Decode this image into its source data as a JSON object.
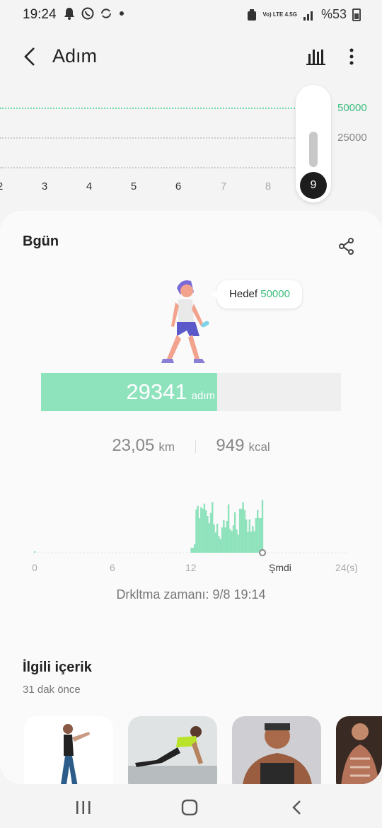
{
  "status_bar": {
    "time": "19:24",
    "left_icons": [
      "notification-icon",
      "whatsapp-icon",
      "sync-icon",
      "dot-icon"
    ],
    "network": "Vo) LTE 4.5G",
    "battery": "%53"
  },
  "header": {
    "title": "Adım",
    "back_icon": "back-arrow-icon",
    "chart_icon": "bar-chart-icon",
    "more_icon": "more-vert-icon"
  },
  "top_chart": {
    "goal_label": "50000",
    "mid_label": "25000",
    "days": [
      "2",
      "3",
      "4",
      "5",
      "6",
      "7",
      "8"
    ],
    "selected_day": "9"
  },
  "today_card": {
    "title": "Bgün",
    "share_icon": "share-icon",
    "goal_prefix": "Hedef",
    "goal_value": "50000",
    "steps": "29341",
    "steps_unit": "adım",
    "progress_fraction": 0.587,
    "distance": "23,05",
    "distance_unit": "km",
    "calories": "949",
    "calories_unit": "kcal",
    "hourly_axis": [
      "0",
      "6",
      "12",
      "Şmdi",
      "24(s)"
    ],
    "sync_text": "Drkltma zamanı: 9/8 19:14"
  },
  "chart_data": {
    "type": "bar",
    "title": "",
    "xlabel": "",
    "ylabel": "",
    "x_ticks": [
      "0",
      "6",
      "12",
      "Şmdi",
      "24(s)"
    ],
    "hours_range": [
      0,
      24
    ],
    "bars_relative_height": [
      0.02,
      0,
      0,
      0,
      0,
      0,
      0,
      0,
      0,
      0,
      0,
      0,
      0,
      0,
      0,
      0,
      0,
      0,
      0,
      0,
      0,
      0,
      0,
      0,
      0,
      0,
      0,
      0,
      0,
      0,
      0,
      0,
      0,
      0,
      0,
      0,
      0,
      0,
      0,
      0,
      0,
      0,
      0,
      0,
      0,
      0,
      0,
      0,
      0,
      0,
      0,
      0,
      0,
      0,
      0,
      0,
      0,
      0,
      0,
      0,
      0,
      0,
      0,
      0,
      0,
      0,
      0,
      0,
      0,
      0,
      0,
      0,
      0,
      0,
      0,
      0,
      0,
      0,
      0,
      0,
      0,
      0,
      0,
      0,
      0,
      0,
      0,
      0,
      0,
      0,
      0,
      0,
      0,
      0,
      0,
      0,
      0,
      0.07,
      0.07,
      0.12,
      0.6,
      0.65,
      0.48,
      0.63,
      0.61,
      0.68,
      0.59,
      0.51,
      0.41,
      0.55,
      0.7,
      0.39,
      0.28,
      0.4,
      0.23,
      0.19,
      0.35,
      0.45,
      0.35,
      0.44,
      0.67,
      0.33,
      0.3,
      0.38,
      0.56,
      0.32,
      0.25,
      0.61,
      0.61,
      0.7,
      0.59,
      0.46,
      0.29,
      0.46,
      0.29,
      0.37,
      0.3,
      0.48,
      0.59,
      0.48,
      0.48,
      0.73
    ],
    "now_hour_fraction": 0.73,
    "bar_color": "#8ee2bc"
  },
  "related": {
    "title": "İlgili içerik",
    "subtitle": "31 dak önce",
    "thumbs": [
      "stretching-woman-image",
      "exercising-woman-image",
      "bodybuilder-image",
      "muscle-anatomy-image"
    ]
  },
  "nav": {
    "recent_icon": "recent-apps-icon",
    "home_icon": "home-icon",
    "back_icon": "nav-back-icon"
  },
  "colors": {
    "accent_green": "#3cbc7d",
    "progress_fill": "#8ee2bc",
    "progress_track": "#efefef"
  }
}
